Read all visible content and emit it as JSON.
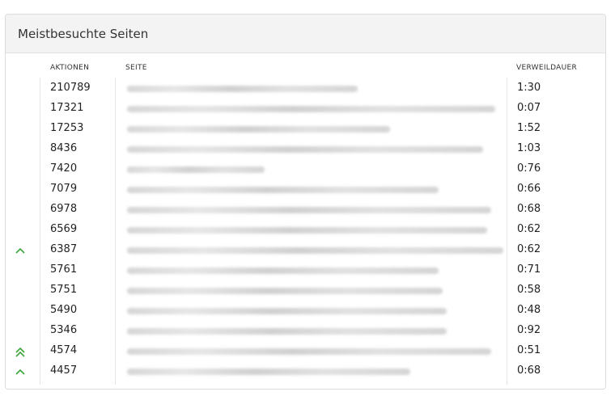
{
  "panel": {
    "title": "Meistbesuchte Seiten"
  },
  "columns": {
    "actions": "AKTIONEN",
    "page": "SEITE",
    "duration": "VERWEILDAUER"
  },
  "rows": [
    {
      "actions": "210789",
      "duration": "1:30",
      "trend": "none"
    },
    {
      "actions": "17321",
      "duration": "0:07",
      "trend": "none"
    },
    {
      "actions": "17253",
      "duration": "1:52",
      "trend": "none"
    },
    {
      "actions": "8436",
      "duration": "1:03",
      "trend": "none"
    },
    {
      "actions": "7420",
      "duration": "0:76",
      "trend": "none"
    },
    {
      "actions": "7079",
      "duration": "0:66",
      "trend": "none"
    },
    {
      "actions": "6978",
      "duration": "0:68",
      "trend": "none"
    },
    {
      "actions": "6569",
      "duration": "0:62",
      "trend": "none"
    },
    {
      "actions": "6387",
      "duration": "0:62",
      "trend": "up"
    },
    {
      "actions": "5761",
      "duration": "0:71",
      "trend": "none"
    },
    {
      "actions": "5751",
      "duration": "0:58",
      "trend": "none"
    },
    {
      "actions": "5490",
      "duration": "0:48",
      "trend": "none"
    },
    {
      "actions": "5346",
      "duration": "0:92",
      "trend": "none"
    },
    {
      "actions": "4574",
      "duration": "0:51",
      "trend": "double-up"
    },
    {
      "actions": "4457",
      "duration": "0:68",
      "trend": "up"
    }
  ],
  "colors": {
    "trend_up": "#3aa63a"
  }
}
